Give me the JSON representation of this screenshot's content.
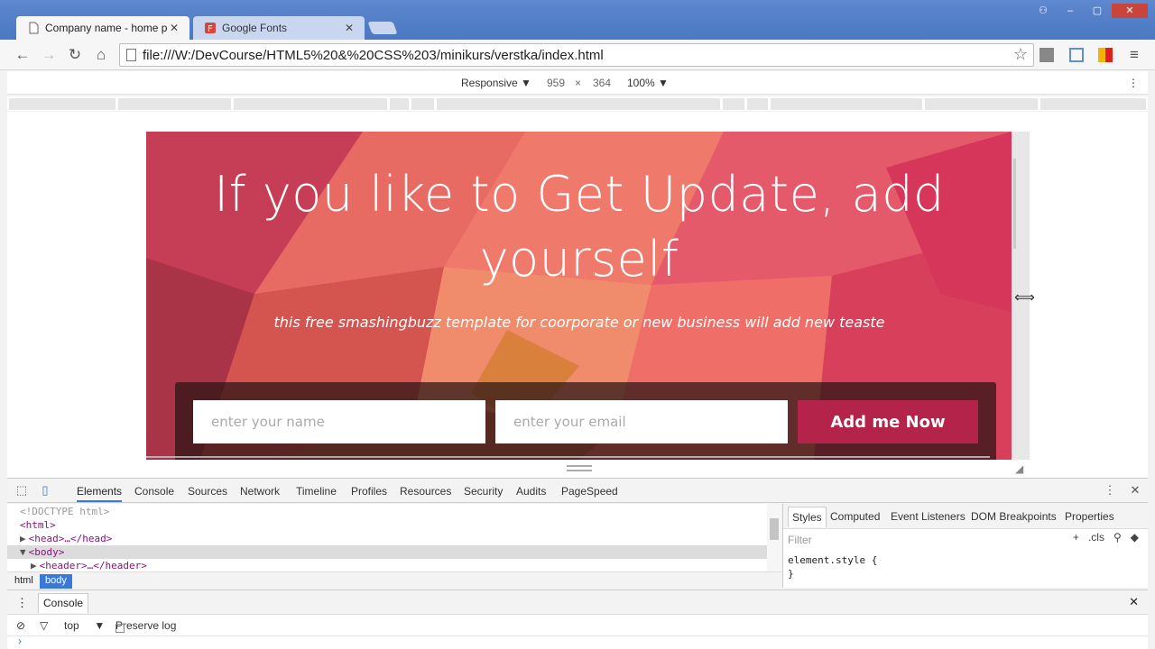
{
  "browser": {
    "tabs": [
      {
        "title": "Company name - home p",
        "active": true
      },
      {
        "title": "Google Fonts",
        "active": false
      }
    ],
    "url": "file:///W:/DevCourse/HTML5%20&%20CSS%203/minikurs/verstka/index.html"
  },
  "device_toolbar": {
    "mode": "Responsive",
    "width": "959",
    "separator": "×",
    "height": "364",
    "zoom": "100%"
  },
  "page": {
    "hero_title": "If you like to Get Update, add yourself",
    "hero_subtitle": "this free smashingbuzz template for coorporate or new business will add new teaste",
    "name_placeholder": "enter your name",
    "email_placeholder": "enter your email",
    "submit_label": "Add me Now",
    "colors": {
      "accent": "#b3234a",
      "hero_base": "#e9505f"
    }
  },
  "devtools": {
    "tabs": [
      "Elements",
      "Console",
      "Sources",
      "Network",
      "Timeline",
      "Profiles",
      "Resources",
      "Security",
      "Audits",
      "PageSpeed"
    ],
    "active_tab": "Elements",
    "dom_lines": [
      {
        "text": "<!DOCTYPE html>",
        "toggle": ""
      },
      {
        "text": "<html>",
        "toggle": ""
      },
      {
        "text": "<head>…</head>",
        "toggle": "▶"
      },
      {
        "text": "<body>",
        "toggle": "▼"
      },
      {
        "text": "<header>…</header>",
        "toggle": "▶"
      }
    ],
    "breadcrumbs": [
      "html",
      "body"
    ],
    "styles_tabs": [
      "Styles",
      "Computed",
      "Event Listeners",
      "DOM Breakpoints",
      "Properties"
    ],
    "filter_placeholder": "Filter",
    "filter_cls": ".cls",
    "element_style_open": "element.style {",
    "element_style_close": "}",
    "drawer_tab": "Console",
    "console_context": "top",
    "preserve_log_label": "Preserve log"
  }
}
